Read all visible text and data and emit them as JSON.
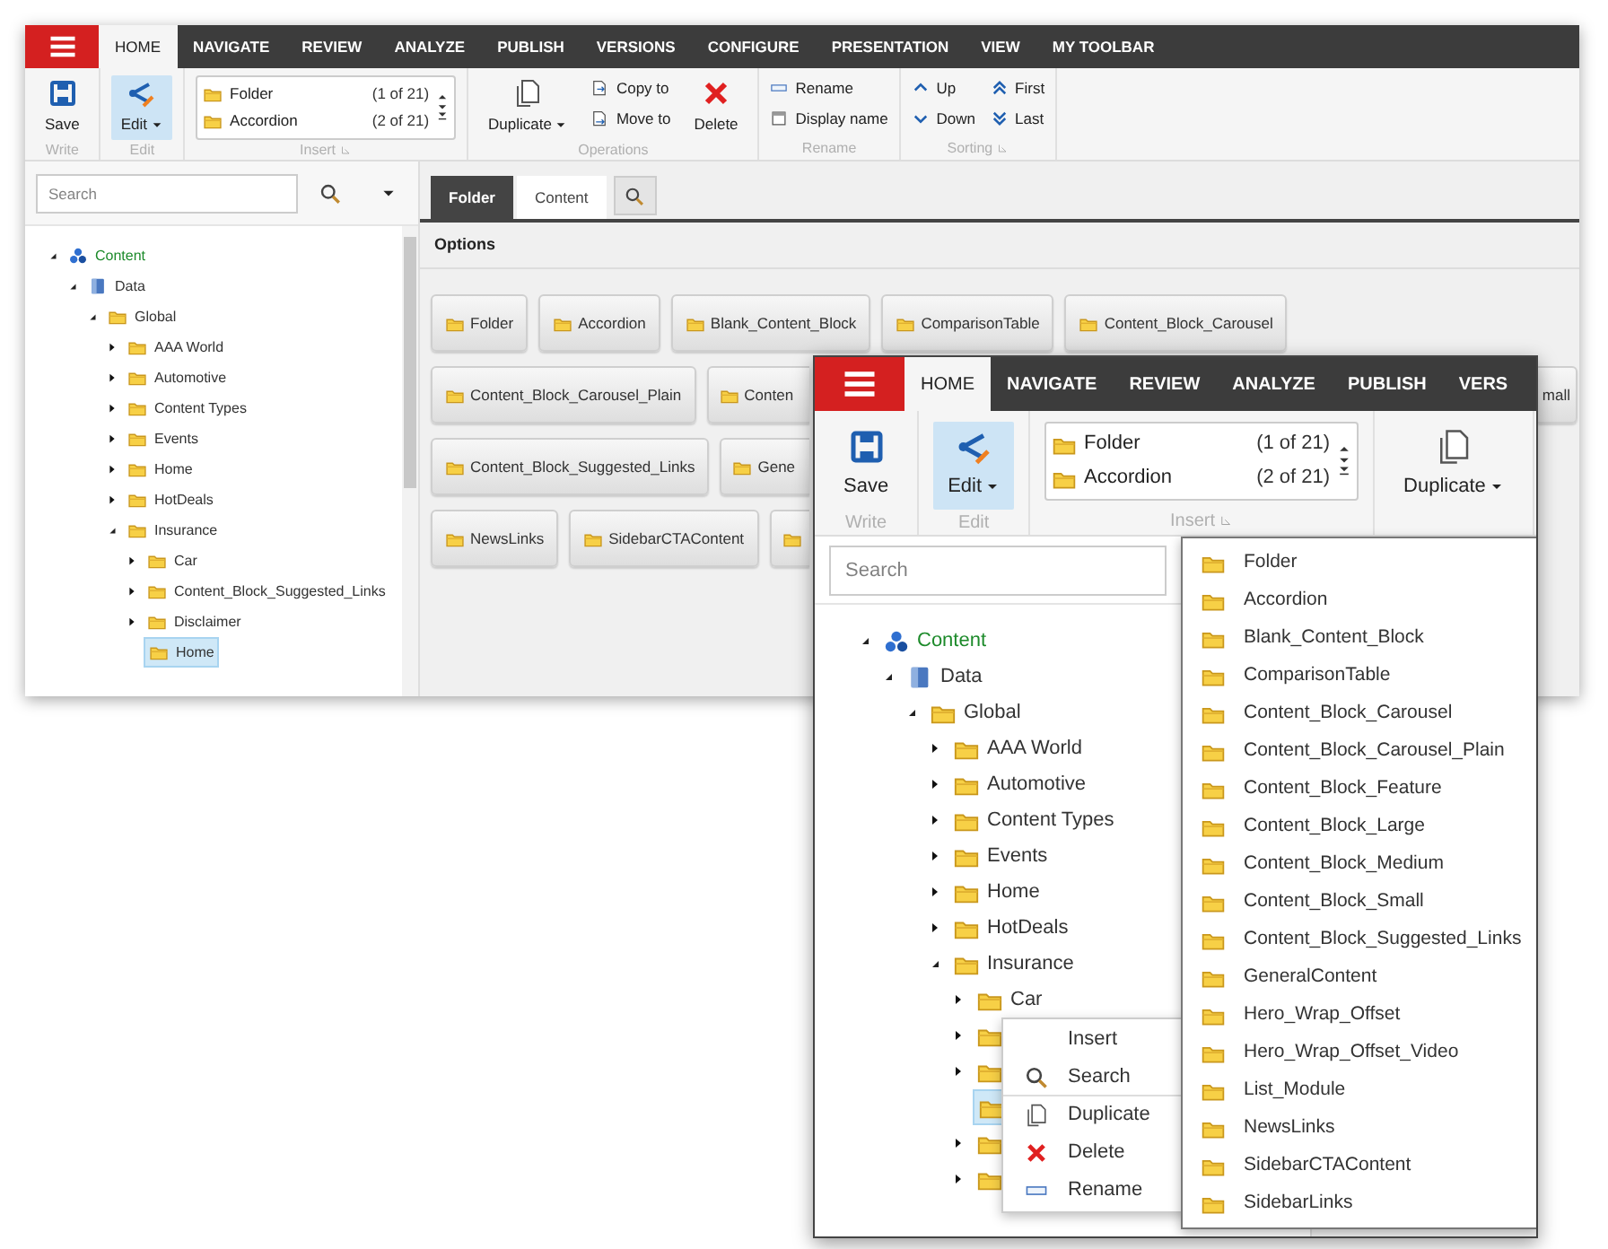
{
  "back_window": {
    "tabs": [
      {
        "label": "HOME",
        "selected": true
      },
      {
        "label": "NAVIGATE",
        "selected": false
      },
      {
        "label": "REVIEW",
        "selected": false
      },
      {
        "label": "ANALYZE",
        "selected": false
      },
      {
        "label": "PUBLISH",
        "selected": false
      },
      {
        "label": "VERSIONS",
        "selected": false
      },
      {
        "label": "CONFIGURE",
        "selected": false
      },
      {
        "label": "PRESENTATION",
        "selected": false
      },
      {
        "label": "VIEW",
        "selected": false
      },
      {
        "label": "MY TOOLBAR",
        "selected": false
      }
    ],
    "ribbon": [
      {
        "label": "Write",
        "launcher": false,
        "kind": "buttons",
        "buttons": [
          {
            "kind": "save",
            "label": "Save",
            "active": false
          }
        ]
      },
      {
        "label": "Edit",
        "launcher": false,
        "kind": "buttons",
        "buttons": [
          {
            "kind": "edit",
            "label": "Edit",
            "active": true
          }
        ]
      },
      {
        "label": "Insert",
        "launcher": true,
        "kind": "insert",
        "items": [
          {
            "label": "Folder",
            "count": "(1 of 21)"
          },
          {
            "label": "Accordion",
            "count": "(2 of 21)"
          }
        ]
      },
      {
        "label": "Operations",
        "launcher": false,
        "kind": "buttons",
        "buttons": [
          {
            "kind": "duplicate",
            "label": "Duplicate",
            "active": false
          },
          {
            "kind": "copy",
            "label": "Copy to",
            "active": false
          },
          {
            "kind": "move",
            "label": "Move to",
            "active": false
          },
          {
            "kind": "delete",
            "label": "Delete",
            "active": false
          }
        ]
      },
      {
        "label": "Rename",
        "launcher": false,
        "kind": "buttons",
        "buttons": [
          {
            "kind": "rename",
            "label": "Rename",
            "active": false
          },
          {
            "kind": "display_name",
            "label": "Display name",
            "active": false
          }
        ]
      },
      {
        "label": "Sorting",
        "launcher": true,
        "kind": "buttons",
        "buttons": [
          {
            "kind": "up",
            "label": "Up",
            "active": false
          },
          {
            "kind": "down",
            "label": "Down",
            "active": false
          },
          {
            "kind": "first",
            "label": "First",
            "active": false
          },
          {
            "kind": "last",
            "label": "Last",
            "active": false
          }
        ]
      }
    ],
    "search": {
      "placeholder": "Search"
    },
    "tree": [
      {
        "label": "Content",
        "kind": "root",
        "expanded": true,
        "selected": false,
        "children": [
          {
            "label": "Data",
            "kind": "database",
            "expanded": true,
            "selected": false,
            "children": [
              {
                "label": "Global",
                "kind": "folder",
                "expanded": true,
                "selected": false,
                "children": [
                  {
                    "label": "AAA World",
                    "kind": "folder",
                    "expanded": false,
                    "selected": false
                  },
                  {
                    "label": "Automotive",
                    "kind": "folder",
                    "expanded": false,
                    "selected": false
                  },
                  {
                    "label": "Content Types",
                    "kind": "folder",
                    "expanded": false,
                    "selected": false
                  },
                  {
                    "label": "Events",
                    "kind": "folder",
                    "expanded": false,
                    "selected": false
                  },
                  {
                    "label": "Home",
                    "kind": "folder",
                    "expanded": false,
                    "selected": false
                  },
                  {
                    "label": "HotDeals",
                    "kind": "folder",
                    "expanded": false,
                    "selected": false
                  },
                  {
                    "label": "Insurance",
                    "kind": "folder",
                    "expanded": true,
                    "selected": false,
                    "children": [
                      {
                        "label": "Car",
                        "kind": "folder",
                        "expanded": false,
                        "selected": false
                      },
                      {
                        "label": "Content_Block_Suggested_Links",
                        "kind": "folder",
                        "expanded": false,
                        "selected": false
                      },
                      {
                        "label": "Disclaimer",
                        "kind": "folder",
                        "expanded": false,
                        "selected": false
                      },
                      {
                        "label": "Home",
                        "kind": "folder",
                        "selected": true
                      }
                    ]
                  }
                ]
              }
            ]
          }
        ]
      }
    ],
    "panel_tabs": [
      {
        "label": "Folder",
        "selected": true
      },
      {
        "label": "Content",
        "selected": false
      }
    ],
    "options": {
      "title": "Options",
      "rows": [
        {
          "buttons": [
            {
              "label": "Folder",
              "kind": "full"
            },
            {
              "label": "Accordion",
              "kind": "full"
            },
            {
              "label": "Blank_Content_Block",
              "kind": "full"
            },
            {
              "label": "ComparisonTable",
              "kind": "full"
            },
            {
              "label": "Content_Block_Carousel",
              "kind": "full"
            }
          ]
        },
        {
          "buttons": [
            {
              "label": "Content_Block_Carousel_Plain",
              "kind": "full"
            },
            {
              "label": "Conten",
              "kind": "clipped_right"
            },
            {
              "label": "mall",
              "kind": "clipped_left"
            }
          ]
        },
        {
          "buttons": [
            {
              "label": "Content_Block_Suggested_Links",
              "kind": "full"
            },
            {
              "label": "Gene",
              "kind": "clipped_right"
            }
          ]
        },
        {
          "buttons": [
            {
              "label": "NewsLinks",
              "kind": "full"
            },
            {
              "label": "SidebarCTAContent",
              "kind": "full"
            },
            {
              "kind": "clipped_right"
            }
          ]
        }
      ]
    }
  },
  "front_window": {
    "tabs": [
      {
        "label": "HOME",
        "selected": true
      },
      {
        "label": "NAVIGATE",
        "selected": false
      },
      {
        "label": "REVIEW",
        "selected": false
      },
      {
        "label": "ANALYZE",
        "selected": false
      },
      {
        "label": "PUBLISH",
        "selected": false
      },
      {
        "label": "VERS",
        "selected": false
      }
    ],
    "ribbon": [
      {
        "label": "Write",
        "launcher": false,
        "kind": "buttons",
        "buttons": [
          {
            "kind": "save",
            "label": "Save",
            "active": false
          }
        ]
      },
      {
        "label": "Edit",
        "launcher": false,
        "kind": "buttons",
        "buttons": [
          {
            "kind": "edit",
            "label": "Edit",
            "active": true
          }
        ]
      },
      {
        "label": "Insert",
        "launcher": true,
        "kind": "insert",
        "items": [
          {
            "label": "Folder",
            "count": "(1 of 21)"
          },
          {
            "label": "Accordion",
            "count": "(2 of 21)"
          }
        ]
      },
      {
        "launcher": false,
        "kind": "buttons",
        "buttons": [
          {
            "kind": "duplicate",
            "label": "Duplicate",
            "active": false
          }
        ]
      }
    ],
    "search": {
      "placeholder": "Search"
    },
    "tree": [
      {
        "label": "Content",
        "kind": "root",
        "expanded": true,
        "selected": false,
        "children": [
          {
            "label": "Data",
            "kind": "database",
            "expanded": true,
            "selected": false,
            "children": [
              {
                "label": "Global",
                "kind": "folder",
                "expanded": true,
                "selected": false,
                "children": [
                  {
                    "label": "AAA World",
                    "kind": "folder",
                    "expanded": false,
                    "selected": false
                  },
                  {
                    "label": "Automotive",
                    "kind": "folder",
                    "expanded": false,
                    "selected": false
                  },
                  {
                    "label": "Content Types",
                    "kind": "folder",
                    "expanded": false,
                    "selected": false
                  },
                  {
                    "label": "Events",
                    "kind": "folder",
                    "expanded": false,
                    "selected": false
                  },
                  {
                    "label": "Home",
                    "kind": "folder",
                    "expanded": false,
                    "selected": false
                  },
                  {
                    "label": "HotDeals",
                    "kind": "folder",
                    "expanded": false,
                    "selected": false
                  },
                  {
                    "label": "Insurance",
                    "kind": "folder",
                    "expanded": true,
                    "selected": false,
                    "children": [
                      {
                        "label": "Car",
                        "kind": "folder",
                        "expanded": false,
                        "selected": false
                      },
                      {
                        "kind": "folder",
                        "expanded": false,
                        "selected": false
                      },
                      {
                        "kind": "folder",
                        "expanded": false,
                        "selected": false
                      },
                      {
                        "kind": "folder",
                        "selected": true
                      },
                      {
                        "kind": "folder",
                        "expanded": false,
                        "selected": false
                      },
                      {
                        "kind": "folder",
                        "expanded": false,
                        "selected": false
                      }
                    ]
                  }
                ]
              }
            ]
          }
        ]
      }
    ],
    "context_menu": [
      {
        "kind": "insert",
        "label": "Insert",
        "submenu": true
      },
      {
        "kind": "search",
        "label": "Search",
        "submenu": false
      },
      {
        "kind": "duplicate",
        "label": "Duplicate",
        "submenu": false
      },
      {
        "kind": "delete",
        "label": "Delete",
        "submenu": false
      },
      {
        "kind": "rename",
        "label": "Rename",
        "submenu": false
      }
    ],
    "insert_list": [
      "Folder",
      "Accordion",
      "Blank_Content_Block",
      "ComparisonTable",
      "Content_Block_Carousel",
      "Content_Block_Carousel_Plain",
      "Content_Block_Feature",
      "Content_Block_Large",
      "Content_Block_Medium",
      "Content_Block_Small",
      "Content_Block_Suggested_Links",
      "GeneralContent",
      "Hero_Wrap_Offset",
      "Hero_Wrap_Offset_Video",
      "List_Module",
      "NewsLinks",
      "SidebarCTAContent",
      "SidebarLinks"
    ]
  }
}
